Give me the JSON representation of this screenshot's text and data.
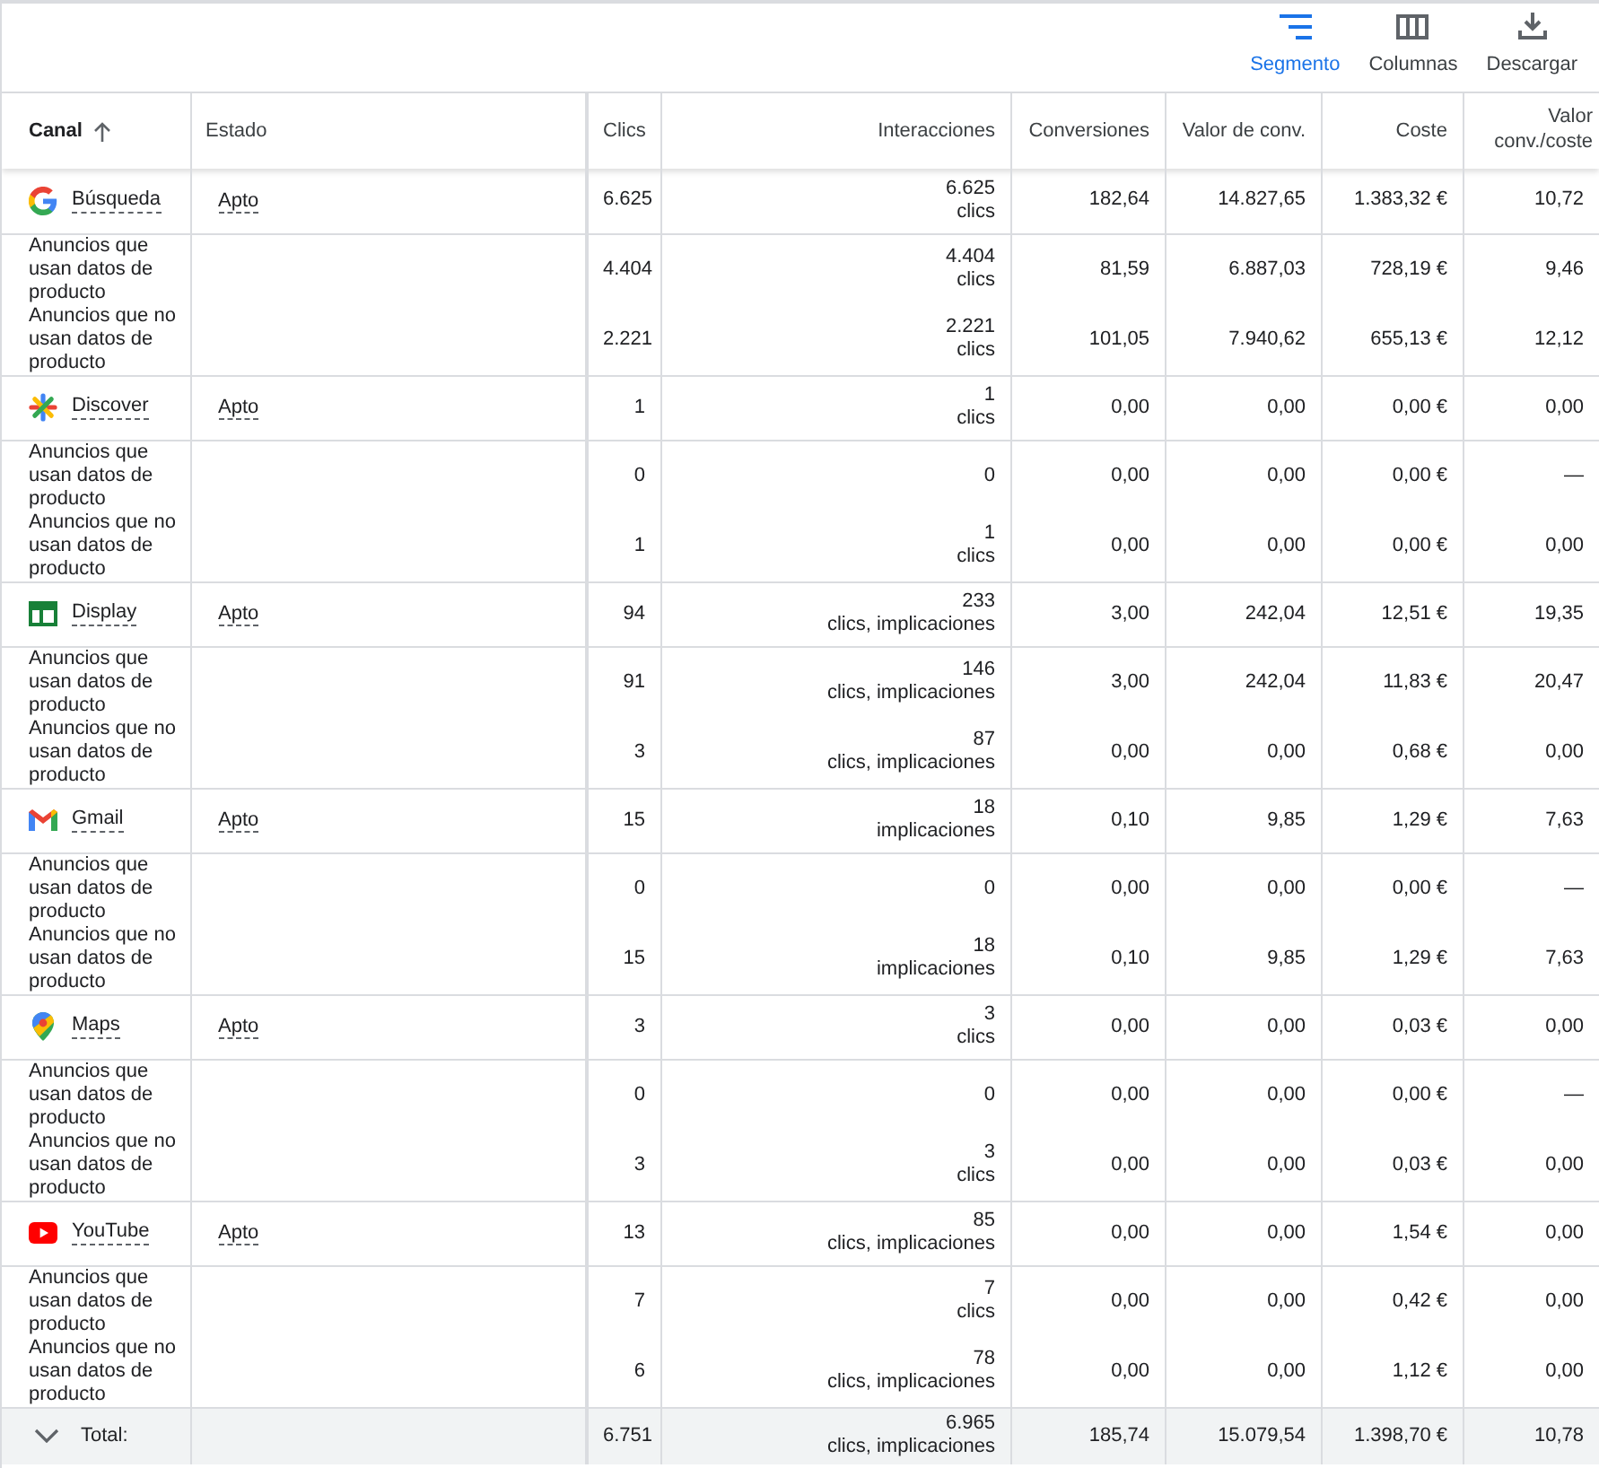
{
  "toolbar": [
    {
      "kind": "segment",
      "label": "Segmento",
      "selected": true
    },
    {
      "kind": "columns",
      "label": "Columnas",
      "selected": false
    },
    {
      "kind": "download",
      "label": "Descargar",
      "selected": false
    }
  ],
  "columns": [
    "Canal",
    "Estado",
    "Clics",
    "Interacciones",
    "Conversiones",
    "Valor de conv.",
    "Coste",
    "Valor conv./coste"
  ],
  "rows": [
    {
      "kind": "google",
      "name": "Búsqueda",
      "status": "Apto",
      "clicks": "6.625",
      "interactions": "6.625",
      "interaction_type": "clics",
      "conversions": "182,64",
      "conv_value": "14.827,65",
      "cost": "1.383,32 €",
      "value_per_cost": "10,72",
      "segments": [
        {
          "label": "Anuncios que usan datos de producto",
          "clicks": "4.404",
          "interactions": "4.404",
          "interaction_type": "clics",
          "conversions": "81,59",
          "conv_value": "6.887,03",
          "cost": "728,19 €",
          "value_per_cost": "9,46"
        },
        {
          "label": "Anuncios que no usan datos de producto",
          "clicks": "2.221",
          "interactions": "2.221",
          "interaction_type": "clics",
          "conversions": "101,05",
          "conv_value": "7.940,62",
          "cost": "655,13 €",
          "value_per_cost": "12,12"
        }
      ]
    },
    {
      "kind": "discover",
      "name": "Discover",
      "status": "Apto",
      "clicks": "1",
      "interactions": "1",
      "interaction_type": "clics",
      "conversions": "0,00",
      "conv_value": "0,00",
      "cost": "0,00 €",
      "value_per_cost": "0,00",
      "segments": [
        {
          "label": "Anuncios que usan datos de producto",
          "clicks": "0",
          "interactions": "0",
          "conversions": "0,00",
          "conv_value": "0,00",
          "cost": "0,00 €",
          "value_per_cost": "—"
        },
        {
          "label": "Anuncios que no usan datos de producto",
          "clicks": "1",
          "interactions": "1",
          "interaction_type": "clics",
          "conversions": "0,00",
          "conv_value": "0,00",
          "cost": "0,00 €",
          "value_per_cost": "0,00"
        }
      ]
    },
    {
      "kind": "display",
      "name": "Display",
      "status": "Apto",
      "clicks": "94",
      "interactions": "233",
      "interaction_type": "clics, implicaciones",
      "conversions": "3,00",
      "conv_value": "242,04",
      "cost": "12,51 €",
      "value_per_cost": "19,35",
      "segments": [
        {
          "label": "Anuncios que usan datos de producto",
          "clicks": "91",
          "interactions": "146",
          "interaction_type": "clics, implicaciones",
          "conversions": "3,00",
          "conv_value": "242,04",
          "cost": "11,83 €",
          "value_per_cost": "20,47"
        },
        {
          "label": "Anuncios que no usan datos de producto",
          "clicks": "3",
          "interactions": "87",
          "interaction_type": "clics, implicaciones",
          "conversions": "0,00",
          "conv_value": "0,00",
          "cost": "0,68 €",
          "value_per_cost": "0,00"
        }
      ]
    },
    {
      "kind": "gmail",
      "name": "Gmail",
      "status": "Apto",
      "clicks": "15",
      "interactions": "18",
      "interaction_type": "implicaciones",
      "conversions": "0,10",
      "conv_value": "9,85",
      "cost": "1,29 €",
      "value_per_cost": "7,63",
      "segments": [
        {
          "label": "Anuncios que usan datos de producto",
          "clicks": "0",
          "interactions": "0",
          "conversions": "0,00",
          "conv_value": "0,00",
          "cost": "0,00 €",
          "value_per_cost": "—"
        },
        {
          "label": "Anuncios que no usan datos de producto",
          "clicks": "15",
          "interactions": "18",
          "interaction_type": "implicaciones",
          "conversions": "0,10",
          "conv_value": "9,85",
          "cost": "1,29 €",
          "value_per_cost": "7,63"
        }
      ]
    },
    {
      "kind": "maps",
      "name": "Maps",
      "status": "Apto",
      "clicks": "3",
      "interactions": "3",
      "interaction_type": "clics",
      "conversions": "0,00",
      "conv_value": "0,00",
      "cost": "0,03 €",
      "value_per_cost": "0,00",
      "segments": [
        {
          "label": "Anuncios que usan datos de producto",
          "clicks": "0",
          "interactions": "0",
          "conversions": "0,00",
          "conv_value": "0,00",
          "cost": "0,00 €",
          "value_per_cost": "—"
        },
        {
          "label": "Anuncios que no usan datos de producto",
          "clicks": "3",
          "interactions": "3",
          "interaction_type": "clics",
          "conversions": "0,00",
          "conv_value": "0,00",
          "cost": "0,03 €",
          "value_per_cost": "0,00"
        }
      ]
    },
    {
      "kind": "youtube",
      "name": "YouTube",
      "status": "Apto",
      "clicks": "13",
      "interactions": "85",
      "interaction_type": "clics, implicaciones",
      "conversions": "0,00",
      "conv_value": "0,00",
      "cost": "1,54 €",
      "value_per_cost": "0,00",
      "segments": [
        {
          "label": "Anuncios que usan datos de producto",
          "clicks": "7",
          "interactions": "7",
          "interaction_type": "clics",
          "conversions": "0,00",
          "conv_value": "0,00",
          "cost": "0,42 €",
          "value_per_cost": "0,00"
        },
        {
          "label": "Anuncios que no usan datos de producto",
          "clicks": "6",
          "interactions": "78",
          "interaction_type": "clics, implicaciones",
          "conversions": "0,00",
          "conv_value": "0,00",
          "cost": "1,12 €",
          "value_per_cost": "0,00"
        }
      ]
    }
  ],
  "total": {
    "label": "Total:",
    "clicks": "6.751",
    "interactions": "6.965",
    "interaction_type": "clics, implicaciones",
    "conversions": "185,74",
    "conv_value": "15.079,54",
    "cost": "1.398,70 €",
    "value_per_cost": "10,78"
  }
}
